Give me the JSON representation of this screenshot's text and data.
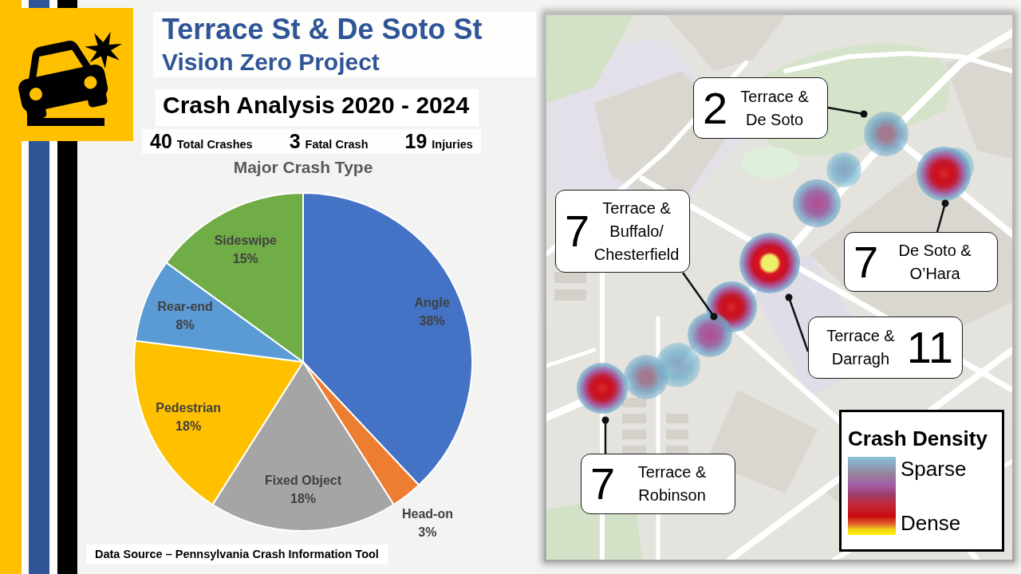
{
  "header": {
    "title": "Terrace St & De Soto St",
    "subtitle": "Vision Zero Project"
  },
  "analysis": {
    "heading": "Crash Analysis 2020 - 2024",
    "stats": [
      {
        "value": "40",
        "label": "Total Crashes"
      },
      {
        "value": "3",
        "label": "Fatal Crash"
      },
      {
        "value": "19",
        "label": "Injuries"
      }
    ]
  },
  "crash_type_chart": {
    "chart_data": {
      "type": "pie",
      "title": "Major Crash Type",
      "categories": [
        "Angle",
        "Head-on",
        "Fixed Object",
        "Pedestrian",
        "Rear-end",
        "Sideswipe"
      ],
      "values": [
        38,
        3,
        18,
        18,
        8,
        15
      ],
      "value_labels": [
        "38%",
        "3%",
        "18%",
        "18%",
        "8%",
        "15%"
      ]
    }
  },
  "source": "Data Source – Pennsylvania Crash Information Tool",
  "map": {
    "callouts": [
      {
        "kind": "leading",
        "count": "2",
        "label": "Terrace &\nDe Soto"
      },
      {
        "kind": "leading",
        "count": "7",
        "label": "Terrace &\nBuffalo/\nChesterfield"
      },
      {
        "kind": "leading",
        "count": "7",
        "label": "De Soto &\nO’Hara"
      },
      {
        "kind": "trailing",
        "count": "11",
        "label": "Terrace &\nDarragh"
      },
      {
        "kind": "leading",
        "count": "7",
        "label": "Terrace &\nRobinson"
      }
    ],
    "legend": {
      "title": "Crash Density",
      "labels": [
        "Sparse",
        "Dense"
      ]
    }
  }
}
